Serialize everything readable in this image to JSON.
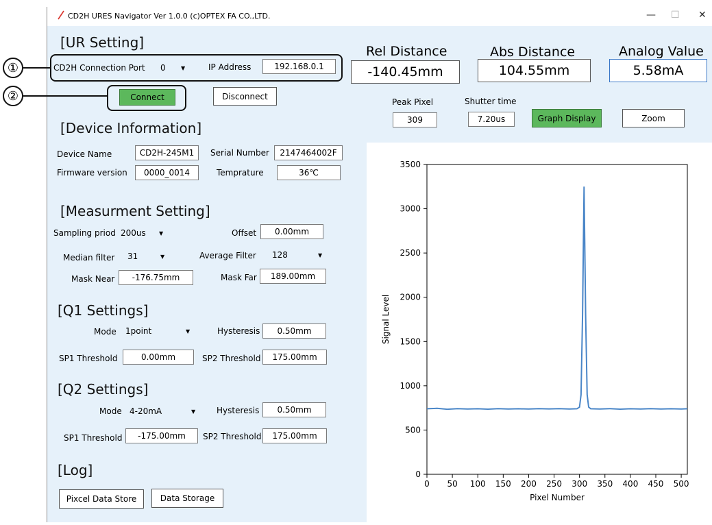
{
  "window": {
    "title": "CD2H URES Navigator Ver 1.0.0 (c)OPTEX FA CO.,LTD.",
    "controls": [
      "—",
      "☐",
      "✕"
    ]
  },
  "callouts": [
    "①",
    "②"
  ],
  "ur_setting": {
    "title": "[UR Setting]",
    "port_label": "CD2H Connection Port",
    "port_value": "0",
    "ip_label": "IP Address",
    "ip_value": "192.168.0.1",
    "connect": "Connect",
    "disconnect": "Disconnect"
  },
  "readouts": {
    "rel_label": "Rel Distance",
    "rel_value": "-140.45mm",
    "abs_label": "Abs Distance",
    "abs_value": "104.55mm",
    "analog_label": "Analog Value",
    "analog_value": "5.58mA",
    "peak_label": "Peak Pixel",
    "peak_value": "309",
    "shutter_label": "Shutter time",
    "shutter_value": "7.20us",
    "graph_button": "Graph Display",
    "zoom_button": "Zoom"
  },
  "device": {
    "title": "[Device Information]",
    "name_label": "Device Name",
    "name_value": "CD2H-245M1",
    "serial_label": "Serial Number",
    "serial_value": "2147464002F",
    "fw_label": "Firmware version",
    "fw_value": "0000_0014",
    "temp_label": "Temprature",
    "temp_value": "36℃"
  },
  "measurement": {
    "title": "[Measurment Setting]",
    "sampling_label": "Sampling priod",
    "sampling_value": "200us",
    "offset_label": "Offset",
    "offset_value": "0.00mm",
    "median_label": "Median filter",
    "median_value": "31",
    "average_label": "Average Filter",
    "average_value": "128",
    "mask_near_label": "Mask Near",
    "mask_near_value": "-176.75mm",
    "mask_far_label": "Mask Far",
    "mask_far_value": "189.00mm"
  },
  "q1": {
    "title": "[Q1 Settings]",
    "mode_label": "Mode",
    "mode_value": "1point",
    "hyst_label": "Hysteresis",
    "hyst_value": "0.50mm",
    "sp1_label": "SP1 Threshold",
    "sp1_value": "0.00mm",
    "sp2_label": "SP2 Threshold",
    "sp2_value": "175.00mm"
  },
  "q2": {
    "title": "[Q2 Settings]",
    "mode_label": "Mode",
    "mode_value": "4-20mA",
    "hyst_label": "Hysteresis",
    "hyst_value": "0.50mm",
    "sp1_label": "SP1 Threshold",
    "sp1_value": "-175.00mm",
    "sp2_label": "SP2 Threshold",
    "sp2_value": "175.00mm"
  },
  "log": {
    "title": "[Log]",
    "pixel_store": "Pixcel Data Store",
    "data_storage": "Data Storage"
  },
  "chart_data": {
    "type": "line",
    "xlabel": "Pixel Number",
    "ylabel": "Signal Level",
    "xlim": [
      0,
      512
    ],
    "ylim": [
      0,
      3500
    ],
    "xticks": [
      0,
      50,
      100,
      150,
      200,
      250,
      300,
      350,
      400,
      450,
      500
    ],
    "yticks": [
      0,
      500,
      1000,
      1500,
      2000,
      2500,
      3000,
      3500
    ],
    "line_color": "#4a86c8",
    "series": [
      {
        "x": [
          0,
          20,
          40,
          60,
          80,
          100,
          120,
          140,
          160,
          180,
          200,
          220,
          240,
          260,
          280,
          295,
          300,
          303,
          306,
          309,
          312,
          315,
          318,
          322,
          340,
          360,
          380,
          400,
          420,
          440,
          460,
          480,
          500,
          512
        ],
        "values": [
          740,
          745,
          735,
          742,
          738,
          740,
          736,
          742,
          738,
          740,
          737,
          741,
          739,
          742,
          738,
          740,
          760,
          900,
          1800,
          3250,
          1800,
          900,
          760,
          740,
          738,
          742,
          736,
          740,
          738,
          741,
          737,
          740,
          738,
          740
        ]
      }
    ]
  }
}
